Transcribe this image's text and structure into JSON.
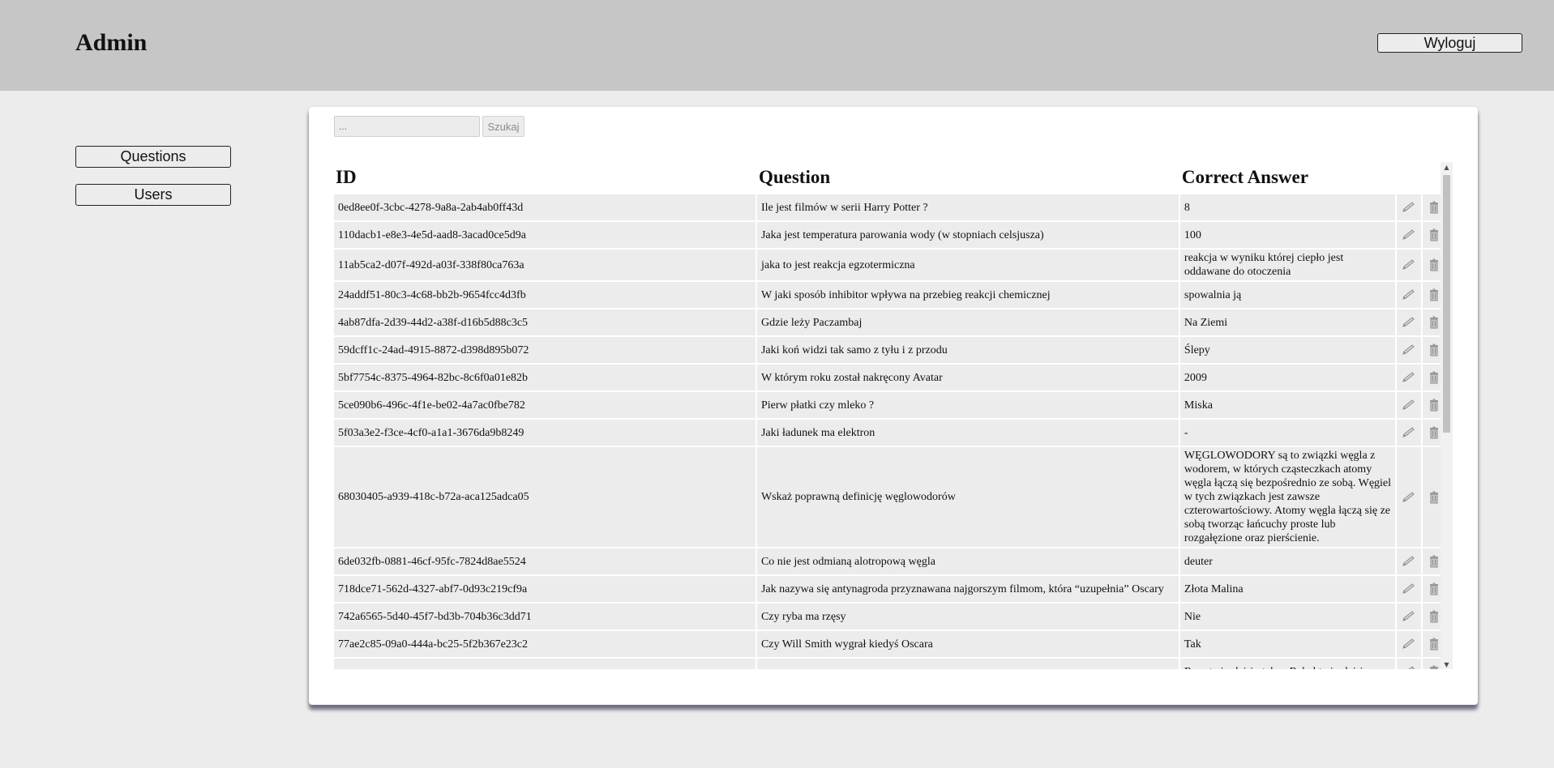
{
  "header": {
    "title": "Admin",
    "logout_label": "Wyloguj"
  },
  "sidebar": {
    "items": [
      {
        "label": "Questions"
      },
      {
        "label": "Users"
      }
    ]
  },
  "search": {
    "placeholder": "...",
    "button_label": "Szukaj"
  },
  "table": {
    "columns": [
      "ID",
      "Question",
      "Correct Answer"
    ],
    "rows": [
      {
        "id": "0ed8ee0f-3cbc-4278-9a8a-2ab4ab0ff43d",
        "question": "Ile jest filmów w serii Harry Potter ?",
        "answer": "8"
      },
      {
        "id": "110dacb1-e8e3-4e5d-aad8-3acad0ce5d9a",
        "question": "Jaka jest temperatura parowania wody (w stopniach celsjusza)",
        "answer": "100"
      },
      {
        "id": "11ab5ca2-d07f-492d-a03f-338f80ca763a",
        "question": "jaka to jest reakcja egzotermiczna",
        "answer": "reakcja w wyniku której ciepło jest oddawane do otoczenia"
      },
      {
        "id": "24addf51-80c3-4c68-bb2b-9654fcc4d3fb",
        "question": "W jaki sposób inhibitor wpływa na przebieg reakcji chemicznej",
        "answer": "spowalnia ją"
      },
      {
        "id": "4ab87dfa-2d39-44d2-a38f-d16b5d88c3c5",
        "question": "Gdzie leży Paczambaj",
        "answer": "Na Ziemi"
      },
      {
        "id": "59dcff1c-24ad-4915-8872-d398d895b072",
        "question": "Jaki koń widzi tak samo z tyłu i z przodu",
        "answer": "Ślepy"
      },
      {
        "id": "5bf7754c-8375-4964-82bc-8c6f0a01e82b",
        "question": "W którym roku został nakręcony Avatar",
        "answer": "2009"
      },
      {
        "id": "5ce090b6-496c-4f1e-be02-4a7ac0fbe782",
        "question": "Pierw płatki czy mleko ?",
        "answer": "Miska"
      },
      {
        "id": "5f03a3e2-f3ce-4cf0-a1a1-3676da9b8249",
        "question": "Jaki ładunek ma elektron",
        "answer": "-"
      },
      {
        "id": "68030405-a939-418c-b72a-aca125adca05",
        "question": "Wskaż poprawną definicję węglowodorów",
        "answer": "WĘGLOWODORY są to związki węgla z wodorem, w których cząsteczkach atomy węgla łączą się bezpośrednio ze sobą. Węgiel w tych związkach jest zawsze czterowartościowy. Atomy węgla łączą się ze sobą tworząc łańcuchy proste lub rozgałęzione oraz pierścienie."
      },
      {
        "id": "6de032fb-0881-46cf-95fc-7824d8ae5524",
        "question": "Co nie jest odmianą alotropową węgla",
        "answer": "deuter"
      },
      {
        "id": "718dce71-562d-4327-abf7-0d93c219cf9a",
        "question": "Jak nazywa się antynagroda przyznawana najgorszym filmom, która “uzupełnia” Oscary",
        "answer": "Złota Malina"
      },
      {
        "id": "742a6565-5d40-45f7-bd3b-704b36c3dd71",
        "question": "Czy ryba ma rzęsy",
        "answer": "Nie"
      },
      {
        "id": "77ae2c85-09a0-444a-bc25-5f2b367e23c2",
        "question": "Czy Will Smith wygrał kiedyś Oscara",
        "answer": "Tak"
      },
      {
        "id": "",
        "question": "",
        "answer": "Ross twierdzi że tak, a Rahel twierdzi że"
      }
    ]
  }
}
